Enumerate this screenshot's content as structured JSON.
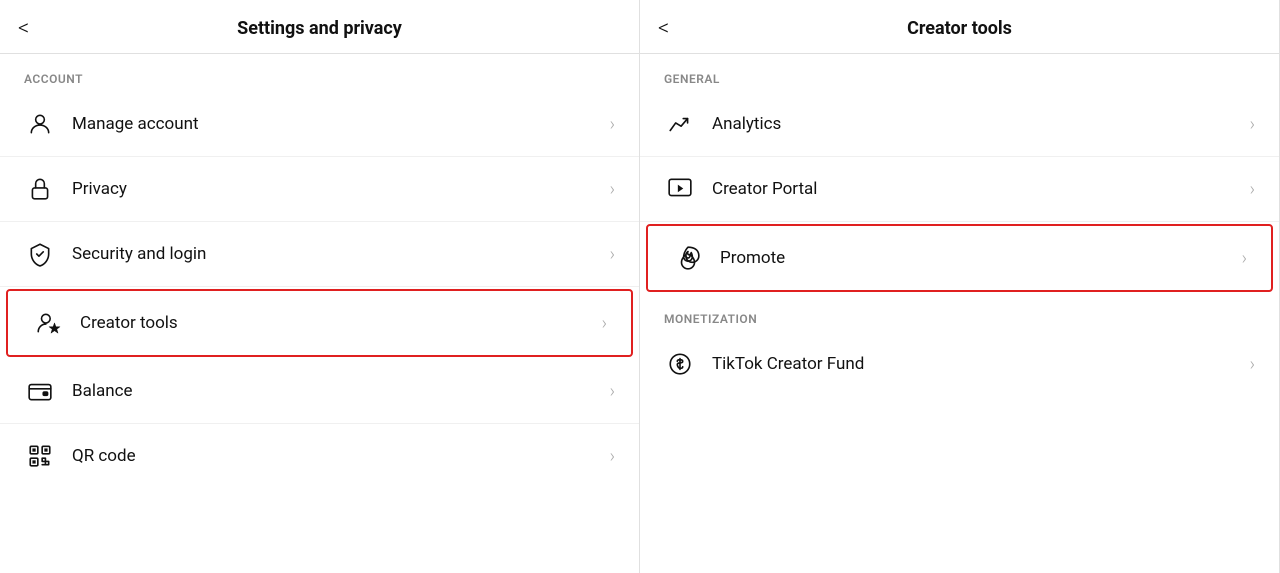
{
  "left_panel": {
    "title": "Settings and privacy",
    "back_label": "<",
    "section_account": "ACCOUNT",
    "items": [
      {
        "id": "manage-account",
        "label": "Manage account",
        "icon": "person",
        "highlighted": false
      },
      {
        "id": "privacy",
        "label": "Privacy",
        "icon": "lock",
        "highlighted": false
      },
      {
        "id": "security-login",
        "label": "Security and login",
        "icon": "shield",
        "highlighted": false
      },
      {
        "id": "creator-tools",
        "label": "Creator tools",
        "icon": "person-star",
        "highlighted": true
      },
      {
        "id": "balance",
        "label": "Balance",
        "icon": "wallet",
        "highlighted": false
      },
      {
        "id": "qr-code",
        "label": "QR code",
        "icon": "qrcode",
        "highlighted": false
      }
    ]
  },
  "right_panel": {
    "title": "Creator tools",
    "back_label": "<",
    "section_general": "General",
    "section_monetization": "Monetization",
    "items": [
      {
        "id": "analytics",
        "label": "Analytics",
        "icon": "chart",
        "section": "general",
        "highlighted": false
      },
      {
        "id": "creator-portal",
        "label": "Creator Portal",
        "icon": "monitor-play",
        "section": "general",
        "highlighted": false
      },
      {
        "id": "promote",
        "label": "Promote",
        "icon": "flame",
        "section": "general",
        "highlighted": true
      },
      {
        "id": "tiktok-creator-fund",
        "label": "TikTok Creator Fund",
        "icon": "dollar-circle",
        "section": "monetization",
        "highlighted": false
      }
    ]
  }
}
